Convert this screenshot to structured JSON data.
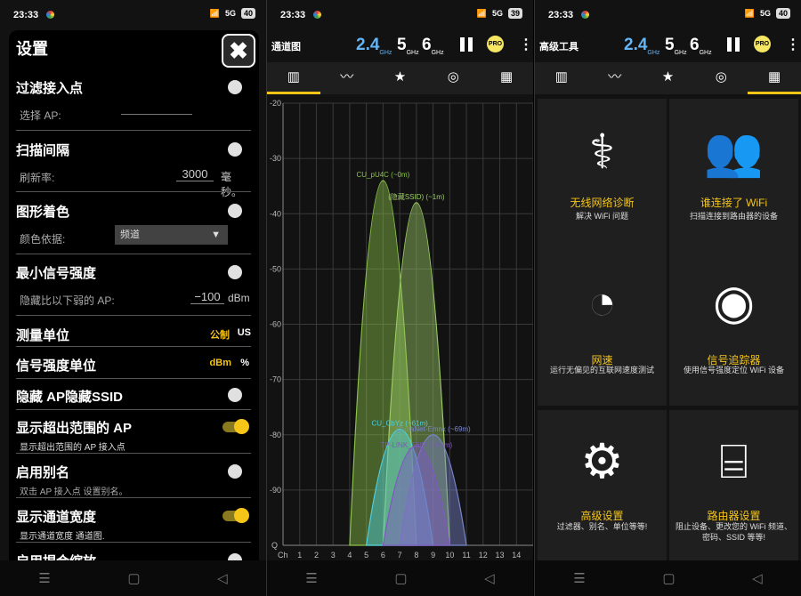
{
  "status": {
    "time": "23:33",
    "net": "5G",
    "battery_left": "40",
    "battery_mid": "39",
    "battery_right": "40"
  },
  "settings": {
    "title": "设置",
    "close": "✖",
    "filter_ap": {
      "title": "过滤接入点",
      "sub": "选择 AP:"
    },
    "scan": {
      "title": "扫描间隔",
      "sub": "刷新率:",
      "value": "3000",
      "unit": "毫秒。"
    },
    "color": {
      "title": "图形着色",
      "sub": "颜色依据:",
      "value": "频道"
    },
    "min_signal": {
      "title": "最小信号强度",
      "sub": "隐藏比以下弱的 AP:",
      "value": "−100",
      "unit": "dBm"
    },
    "measure": {
      "title": "测量单位",
      "opt1": "公制",
      "opt2": "US"
    },
    "strength_unit": {
      "title": "信号强度单位",
      "opt1": "dBm",
      "opt2": "%"
    },
    "hide_ssid": {
      "title": "隐藏 AP隐藏SSID"
    },
    "out_of_range": {
      "title": "显示超出范围的 AP",
      "sub": "显示超出范围的 AP 接入点"
    },
    "alias": {
      "title": "启用别名",
      "sub": "双击 AP 接入点 设置别名。"
    },
    "width": {
      "title": "显示通道宽度",
      "sub": "显示通道宽度 通道图."
    },
    "zoom": {
      "title": "启用捏合缩放"
    }
  },
  "toolbar": {
    "channel_title": "通道图",
    "tools_title": "高级工具",
    "band1": "2.4",
    "band1_unit": "GHz",
    "band2": "5",
    "band2_unit": "GHz",
    "band3": "6",
    "band3_unit": "GHz",
    "pro": "PRO"
  },
  "colors": {
    "accent": "#f5c518",
    "band_selected": "#64b5f6"
  },
  "chart_data": {
    "type": "area",
    "x_label": "Ch",
    "y_label": "Q",
    "y_ticks": [
      -20,
      -30,
      -40,
      -50,
      -60,
      -70,
      -80,
      -90
    ],
    "ylim": [
      -100,
      -20
    ],
    "xlim": [
      0,
      15
    ],
    "x_ticks": [
      1,
      2,
      3,
      4,
      5,
      6,
      7,
      8,
      9,
      10,
      11,
      12,
      13,
      14
    ],
    "grid": true,
    "series": [
      {
        "name": "CU_pU4C (~0m)",
        "channel": 6,
        "signal": -34,
        "color": "#8bc34a"
      },
      {
        "name": "(隐藏SSID) (~1m)",
        "channel": 8,
        "signal": -38,
        "color": "#9ccc65"
      },
      {
        "name": "CU_CbYz (~61m)",
        "channel": 7,
        "signal": -79,
        "color": "#4dd0e1"
      },
      {
        "name": "ChinaNet-Emnk (~69m)",
        "channel": 9,
        "signal": -80,
        "color": "#7986cb"
      },
      {
        "name": "TP-LINK_5687 (~86m)",
        "channel": 8,
        "signal": -82,
        "color": "#7e57c2"
      }
    ]
  },
  "tools": [
    {
      "icon": "stethoscope-icon",
      "glyph": "⚕",
      "label": "无线网络诊断",
      "desc": "解决 WiFi 问题"
    },
    {
      "icon": "users-icon",
      "glyph": "👥",
      "label": "谁连接了 WiFi",
      "desc": "扫描连接到路由器的设备"
    },
    {
      "icon": "speedometer-icon",
      "glyph": "◔",
      "label": "网速",
      "desc": "运行无偏见的互联网速度测试"
    },
    {
      "icon": "signal-tracker-icon",
      "glyph": "◉",
      "label": "信号追踪器",
      "desc": "使用信号强度定位 WiFi 设备"
    },
    {
      "icon": "gear-icon",
      "glyph": "⚙",
      "label": "高级设置",
      "desc": "过滤器、别名、单位等等!"
    },
    {
      "icon": "router-icon",
      "glyph": "⌸",
      "label": "路由器设置",
      "desc": "阻止设备、更改您的 WiFi 频道、密码、SSID 等等!"
    }
  ]
}
